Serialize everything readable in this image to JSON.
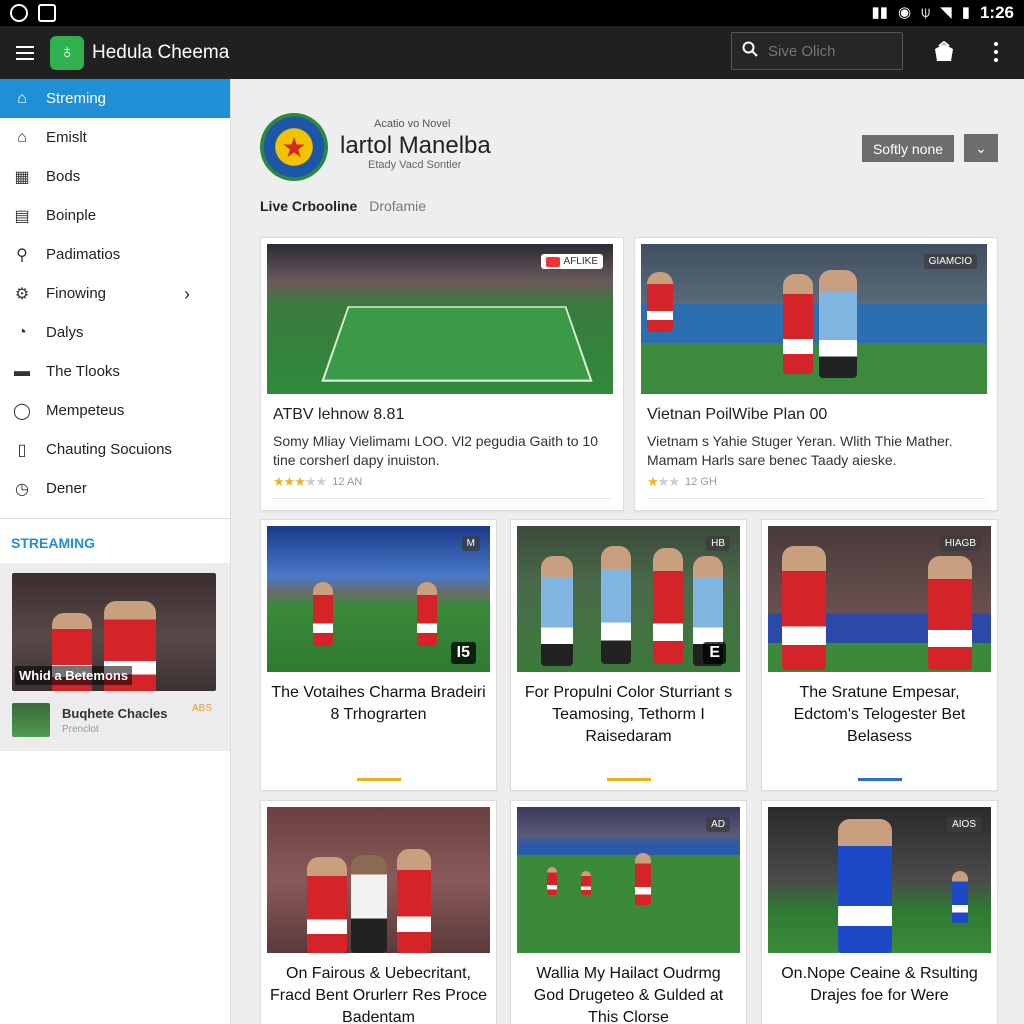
{
  "status": {
    "time": "1:26"
  },
  "app": {
    "title": "Hedula Cheema"
  },
  "search": {
    "placeholder": "Sive Olich"
  },
  "sidebar": {
    "active": "Streming",
    "items": [
      {
        "label": "Emislt",
        "icon": "home-icon"
      },
      {
        "label": "Bods",
        "icon": "grid-icon"
      },
      {
        "label": "Boinple",
        "icon": "newspaper-icon"
      },
      {
        "label": "Padimatios",
        "icon": "search-icon"
      },
      {
        "label": "Finowing",
        "icon": "gear-icon"
      },
      {
        "label": "Dalys",
        "icon": "calendar-icon"
      },
      {
        "label": "The Tlooks",
        "icon": "briefcase-icon"
      },
      {
        "label": "Mempeteus",
        "icon": "chat-icon"
      },
      {
        "label": "Chauting Socuions",
        "icon": "document-icon"
      },
      {
        "label": "Dener",
        "icon": "clock-icon"
      }
    ],
    "section_heading": "STREAMING",
    "feature": {
      "label": "Whid a Betemons",
      "row_title": "Buqhete Chacles",
      "row_sub": "Prenclot",
      "badge": "ABS"
    }
  },
  "header": {
    "kicker": "Acatio vo Novel",
    "title": "lartol Manelba",
    "subtitle": "Etady Vacd Sontler",
    "sort_label": "Softly none",
    "tabs": [
      "Live Crbooline",
      "Drofamie"
    ]
  },
  "cards_wide": [
    {
      "tag": "AFLIKE",
      "title": "ATBV lehnow 8.81",
      "desc": "Somy Mliay Vielimamı LOO. Vl2 pegudia Gaith to 10 tine corsherl dapy inuiston.",
      "rating": 3,
      "meta": "12 AN"
    },
    {
      "tag": "GIAMCIO",
      "title": "Vietnan PoilWibe Plan 00",
      "desc": "Vietnam s Yahie Stuger Yeran. Wlith Thie Mather. Mamam Harls sare benec Taady aieske.",
      "rating": 1,
      "meta": "12 GH"
    }
  ],
  "cards_small": [
    {
      "tag": "M",
      "num": "I5",
      "title": "The Votaihes Charma Bradeiri 8 Trhograrten",
      "bar": "gold"
    },
    {
      "tag": "HB",
      "num": "E",
      "title": "For Propulni Color Sturriant s Teamosing, Tethorm I Raisedaram",
      "bar": "gold"
    },
    {
      "tag": "HIAGB",
      "num": "",
      "title": "The Sratune Empesar, Edctom's Telogester Bet Belasess",
      "bar": "blue"
    },
    {
      "tag": "",
      "num": "",
      "title": "On Fairous & Uebecritant, Fracd Bent Orurlerr Res Proce Badentam",
      "bar": "gold"
    },
    {
      "tag": "AD",
      "num": "",
      "title": "Wallia My Hailact Oudrmg God Drugeteo & Gulded at This Clorse",
      "bar": "gold"
    },
    {
      "tag": "AIOS",
      "num": "",
      "title": "On.Nope Ceaine & Rsulting Drajes foe for Were",
      "bar": "gold"
    }
  ],
  "colors": {
    "accent": "#1f8fd6",
    "appbar": "#202020",
    "logo": "#2fb24d",
    "bar_gold": "#e7b51a",
    "bar_blue": "#2f6fcb"
  }
}
